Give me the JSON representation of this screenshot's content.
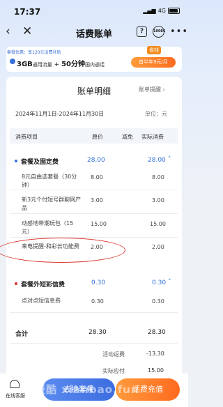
{
  "status": {
    "time": "17:37",
    "network": "4G"
  },
  "nav": {
    "title": "话费账单",
    "help_icon": "?",
    "service_icon": "10086"
  },
  "banner": {
    "tag": "套餐优惠：享120元话费补贴",
    "data_amount": "3GB",
    "data_desc": "通用流量",
    "plus": "+",
    "minutes": "50分钟",
    "minutes_desc": "国内通话",
    "badge": "省钱",
    "button": "首半年9元/月"
  },
  "bill": {
    "heading": "账单明细",
    "remind": "账单提醒 ›",
    "date_range": "2024年11月1日-2024年11月30日",
    "unit": "单位：元",
    "columns": [
      "消费项目",
      "原价",
      "减免",
      "实际消费"
    ],
    "groups": [
      {
        "name": "套餐及固定费",
        "original": "28.00",
        "actual": "28.00",
        "items": [
          {
            "name": "8元自由选套餐（30分钟）",
            "original": "8.00",
            "actual": "8.00"
          },
          {
            "name": "新3元个付短号群聊网产品",
            "original": "3.00",
            "actual": "3.00"
          },
          {
            "name": "动感地带潮玩包（15元）",
            "original": "15.00",
            "actual": "15.00"
          },
          {
            "name": "来电提醒-和彩云功能费",
            "original": "2.00",
            "actual": "2.00"
          }
        ]
      },
      {
        "name": "套餐外短彩信费",
        "original": "0.30",
        "actual": "0.30",
        "items": [
          {
            "name": "点对点短信息费",
            "original": "0.30",
            "actual": "0.30"
          }
        ]
      }
    ],
    "total": {
      "label": "合计",
      "original": "28.30",
      "actual": "28.30"
    },
    "refund": {
      "label": "活动返费",
      "actual": "-13.30"
    },
    "partial": {
      "label": "实际应付",
      "actual": "15.00"
    }
  },
  "bottom": {
    "service_label": "在线客服",
    "btn_package": "去换套餐",
    "btn_recharge": "话费充值",
    "watermark": "报酷 xianbao.fun"
  },
  "colors": {
    "accent": "#2f6fd8",
    "highlight": "#d9342b",
    "orange": "#ff6a1f"
  }
}
